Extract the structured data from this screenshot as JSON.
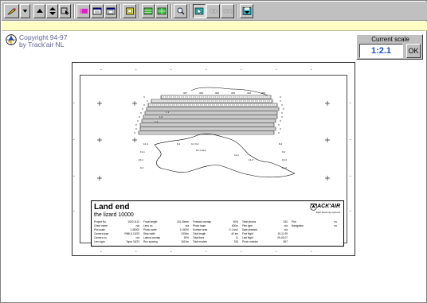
{
  "toolbar": {
    "buttons": [
      {
        "name": "draw-tool",
        "icon": "pen-icon"
      },
      {
        "name": "dropdown",
        "icon": "triangle-down-icon"
      },
      {
        "name": "scroll-up",
        "icon": "triangle-up-icon"
      },
      {
        "name": "resize",
        "icon": "updown-arrow-icon"
      },
      {
        "name": "cursor",
        "icon": "select-arrow-icon"
      },
      {
        "name": "color-layers",
        "icon": "palette-icon"
      },
      {
        "name": "window-a",
        "icon": "window-icon"
      },
      {
        "name": "window-b",
        "icon": "window-icon"
      },
      {
        "name": "frame-yellow",
        "icon": "frame-icon"
      },
      {
        "name": "grid-green",
        "icon": "grid-icon"
      },
      {
        "name": "grid-green-2",
        "icon": "grid-icon"
      },
      {
        "name": "zoom",
        "icon": "magnify-icon"
      },
      {
        "name": "nav-select",
        "icon": "cursor-box-icon"
      },
      {
        "name": "dim-a",
        "icon": "dim-icon"
      },
      {
        "name": "dim-b",
        "icon": "dim-icon"
      },
      {
        "name": "save-floppy",
        "icon": "floppy-icon"
      }
    ]
  },
  "copyright": {
    "line1": "Copyright 94-97",
    "line2": "by Track'air NL"
  },
  "scale": {
    "title": "Current scale",
    "value": "1:2.1",
    "ok_label": "OK"
  },
  "colors": {
    "accent": "#1a4fd6",
    "status_bar": "#ffffc4",
    "chrome": "#c0c0c0"
  },
  "card": {
    "title": "Land end",
    "subtitle": "the lizard 10000",
    "logo": "TRACK'AIR",
    "logo_sub": "flight planning systems",
    "meta": [
      [
        "Project No.",
        "1000 1110"
      ],
      [
        "Focal length",
        "151.30mm"
      ],
      [
        "Forward overlap",
        "60%"
      ],
      [
        "Total photos",
        "332"
      ],
      [
        "Plot",
        "no"
      ],
      [
        "Client name",
        "n/a"
      ],
      [
        "Lens no.",
        "n/a"
      ],
      [
        "Photo base",
        "600m"
      ],
      [
        "Film type",
        "n/a"
      ],
      [
        "Navigation",
        "no"
      ],
      [
        "Plot scale",
        "1:35000"
      ],
      [
        "Photo scale",
        "1:10000"
      ],
      [
        "Surface area",
        "3.1 km2"
      ],
      [
        "Date planned",
        "n/a"
      ],
      [
        "",
        ""
      ],
      [
        "Camera type",
        "RMK A 15/23"
      ],
      [
        "Strip width",
        "2300m"
      ],
      [
        "Total length",
        "40 km"
      ],
      [
        "First flight",
        "15-11-99"
      ],
      [
        "",
        ""
      ],
      [
        "Camera no.",
        "n/a"
      ],
      [
        "Lateral overlap",
        "30%"
      ],
      [
        "Total lines",
        "11"
      ],
      [
        "Last flight",
        "09-03-07"
      ],
      [
        "",
        ""
      ],
      [
        "Lens type",
        "Topar 15/23"
      ],
      [
        "Run spacing",
        "1610m"
      ],
      [
        "Total models",
        "326"
      ],
      [
        "Photo mission",
        "867"
      ],
      [
        "",
        ""
      ]
    ]
  }
}
